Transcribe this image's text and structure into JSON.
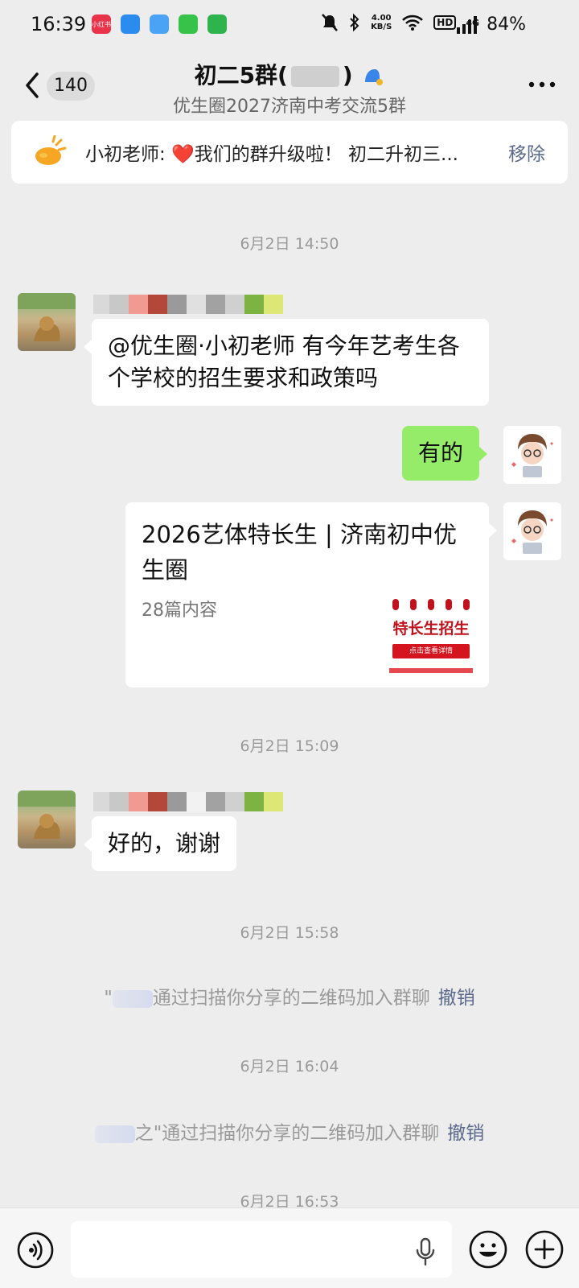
{
  "status_bar": {
    "time": "16:39",
    "app_badge": "小红书",
    "net_speed": "4.00",
    "net_unit": "KB/S",
    "hd_label": "HD",
    "signal_label": "4G",
    "battery": "84%"
  },
  "header": {
    "back_count": "140",
    "title": "初二5群(",
    "title_suffix": ")",
    "subtitle": "优生圈2027济南中考交流5群"
  },
  "notice": {
    "sender": "小初老师: ",
    "heart": "❤️",
    "text": "我们的群升级啦！ 初二升初三...",
    "action": "移除"
  },
  "messages": {
    "ts1": "6月2日 14:50",
    "msg1": "@优生圈·小初老师  有今年艺考生各个学校的招生要求和政策吗",
    "reply1": "有的",
    "card": {
      "title": "2026艺体特长生 | 济南初中优生圈",
      "sub": "28篇内容",
      "thumb_text": "特长生招生",
      "thumb_button": "点击查看详情"
    },
    "ts2": "6月2日 15:09",
    "msg2": "好的，谢谢",
    "ts3": "6月2日 15:58",
    "sys1_prefix": "\"",
    "sys1": "通过扫描你分享的二维码加入群聊",
    "sys1_action": "撤销",
    "ts4": "6月2日 16:04",
    "sys2_prefix": "之\"",
    "sys2": "通过扫描你分享的二维码加入群聊",
    "sys2_action": "撤销",
    "ts5": "6月2日 16:53"
  },
  "input": {
    "placeholder": ""
  },
  "colors": {
    "bubble_green": "#95ec69",
    "link_blue": "#5b6a8c",
    "background": "#ededed"
  }
}
